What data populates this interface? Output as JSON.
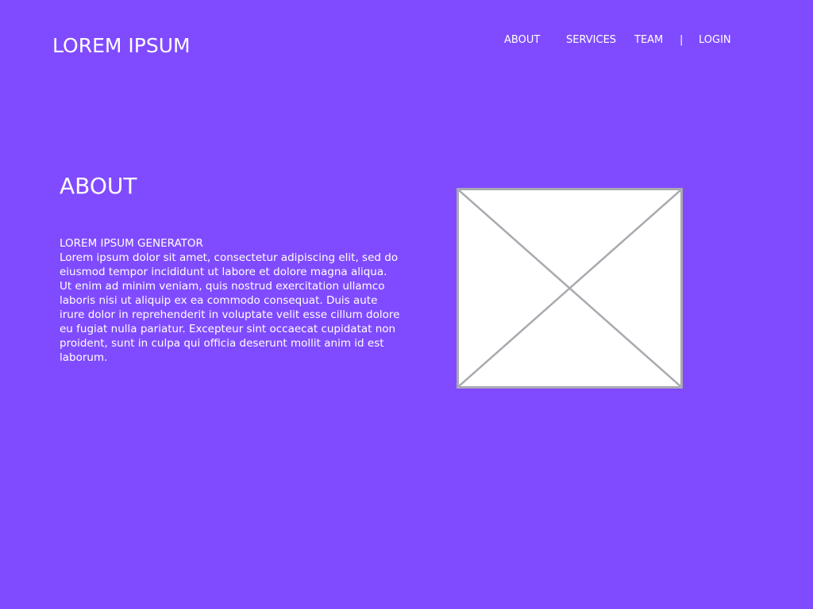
{
  "header": {
    "logo": "LOREM IPSUM",
    "nav": {
      "about": "ABOUT",
      "services": "SERVICES",
      "team": "TEAM",
      "separator": "|",
      "login": "LOGIN"
    }
  },
  "main": {
    "section_title": "ABOUT",
    "subtitle": "LOREM IPSUM GENERATOR",
    "body": "Lorem ipsum dolor sit amet, consectetur adipiscing elit, sed do eiusmod tempor incididunt ut labore et dolore magna aliqua. Ut enim ad minim veniam, quis nostrud exercitation ullamco laboris nisi ut aliquip ex ea commodo consequat. Duis aute irure dolor in reprehenderit in voluptate velit esse cillum dolore eu fugiat nulla pariatur. Excepteur sint occaecat cupidatat non proident, sunt in culpa qui officia deserunt mollit anim id est laborum.",
    "image": {
      "icon": "image-placeholder-icon"
    }
  },
  "colors": {
    "background": "#804bff",
    "text": "#ffffff",
    "placeholder_border": "#a9a9b0",
    "placeholder_fill": "#ffffff"
  }
}
